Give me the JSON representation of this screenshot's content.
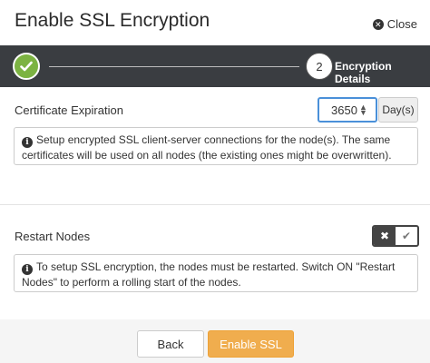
{
  "dialog": {
    "title": "Enable SSL Encryption",
    "close_label": "Close"
  },
  "wizard": {
    "steps": [
      {
        "state": "completed"
      },
      {
        "number": "2",
        "label": "Encryption Details",
        "state": "active"
      }
    ]
  },
  "certificate": {
    "label": "Certificate Expiration",
    "value": "3650",
    "unit": "Day(s)",
    "info": "Setup encrypted SSL client-server connections for the node(s). The same certificates will be used on all nodes (the existing ones might be overwritten)."
  },
  "restart": {
    "label": "Restart Nodes",
    "toggle_state": "off",
    "info": "To setup SSL encryption, the nodes must be restarted. Switch ON \"Restart Nodes\" to perform a rolling start of the nodes."
  },
  "footer": {
    "back_label": "Back",
    "enable_label": "Enable SSL"
  },
  "colors": {
    "wizard_bar": "#3a3d41",
    "step_done": "#7cb342",
    "primary_button": "#f0ad4e",
    "input_focus": "#4a90d9"
  }
}
